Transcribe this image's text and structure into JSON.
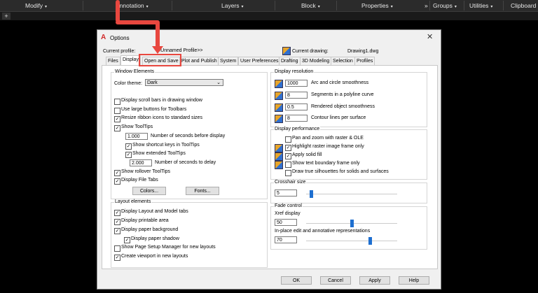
{
  "ribbon": {
    "items": [
      {
        "label": "Modify",
        "caret": "▾"
      },
      {
        "label": "Annotation",
        "caret": "▾"
      },
      {
        "label": "Layers",
        "caret": "▾"
      },
      {
        "label": "Block",
        "caret": "▾"
      },
      {
        "label": "Properties",
        "caret": "▾"
      },
      {
        "label": "»",
        "caret": ""
      },
      {
        "label": "Groups",
        "caret": "▾"
      },
      {
        "label": "Utilities",
        "caret": "▾"
      },
      {
        "label": "Clipboard",
        "caret": ""
      }
    ],
    "plus": "+"
  },
  "dialog": {
    "logo": "A",
    "title": "Options",
    "close": "✕",
    "current_profile_label": "Current profile:",
    "current_profile_value": "<<Unnamed Profile>>",
    "current_drawing_label": "Current drawing:",
    "current_drawing_value": "Drawing1.dwg",
    "tabs": [
      "Files",
      "Display",
      "Open and Save",
      "Plot and Publish",
      "System",
      "User Preferences",
      "Drafting",
      "3D Modeling",
      "Selection",
      "Profiles"
    ],
    "selected_tab": "Display",
    "highlighted_tab": "Open and Save"
  },
  "window_elements": {
    "title": "Window Elements",
    "color_theme_label": "Color theme:",
    "color_theme_value": "Dark",
    "checkboxes": [
      {
        "label": "Display scroll bars in drawing window",
        "checked": false
      },
      {
        "label": "Use large buttons for Toolbars",
        "checked": false
      },
      {
        "label": "Resize ribbon icons to standard sizes",
        "checked": true
      },
      {
        "label": "Show ToolTips",
        "checked": true
      },
      {
        "label": "Show shortcut keys in ToolTips",
        "checked": true
      },
      {
        "label": "Show extended ToolTips",
        "checked": true
      },
      {
        "label": "Show rollover ToolTips",
        "checked": true
      },
      {
        "label": "Display File Tabs",
        "checked": true
      }
    ],
    "tooltip_delay_value": "1.000",
    "tooltip_delay_label": "Number of seconds before display",
    "extended_delay_value": "2.000",
    "extended_delay_label": "Number of seconds to delay",
    "colors_button": "Colors...",
    "fonts_button": "Fonts..."
  },
  "layout_elements": {
    "title": "Layout elements",
    "checkboxes": [
      {
        "label": "Display Layout and Model tabs",
        "checked": true
      },
      {
        "label": "Display printable area",
        "checked": true
      },
      {
        "label": "Display paper background",
        "checked": true
      },
      {
        "label": "Display paper shadow",
        "checked": true
      },
      {
        "label": "Show Page Setup Manager for new layouts",
        "checked": false
      },
      {
        "label": "Create viewport in new layouts",
        "checked": true
      }
    ]
  },
  "display_resolution": {
    "title": "Display resolution",
    "rows": [
      {
        "value": "1000",
        "label": "Arc and circle smoothness"
      },
      {
        "value": "8",
        "label": "Segments in a polyline curve"
      },
      {
        "value": "0.5",
        "label": "Rendered object smoothness"
      },
      {
        "value": "8",
        "label": "Contour lines per surface"
      }
    ]
  },
  "display_performance": {
    "title": "Display performance",
    "checkboxes": [
      {
        "label": "Pan and zoom with raster & OLE",
        "checked": false
      },
      {
        "label": "Highlight raster image frame only",
        "checked": true
      },
      {
        "label": "Apply solid fill",
        "checked": true
      },
      {
        "label": "Show text boundary frame only",
        "checked": false
      },
      {
        "label": "Draw true silhouettes for solids and surfaces",
        "checked": false
      }
    ]
  },
  "crosshair": {
    "title": "Crosshair size",
    "value": "5",
    "level_percent": 5
  },
  "fade": {
    "title": "Fade control",
    "xref_label": "Xref display",
    "xref_value": "50",
    "xref_level_percent": 50,
    "inplace_label": "In-place edit and annotative representations",
    "inplace_value": "70",
    "inplace_level_percent": 70
  },
  "footer": {
    "ok": "OK",
    "cancel": "Cancel",
    "apply": "Apply",
    "help": "Help"
  },
  "colors": {
    "arrow": "#e8473f",
    "slider_thumb": "#1e6fd0",
    "logo": "#d12a2a"
  }
}
